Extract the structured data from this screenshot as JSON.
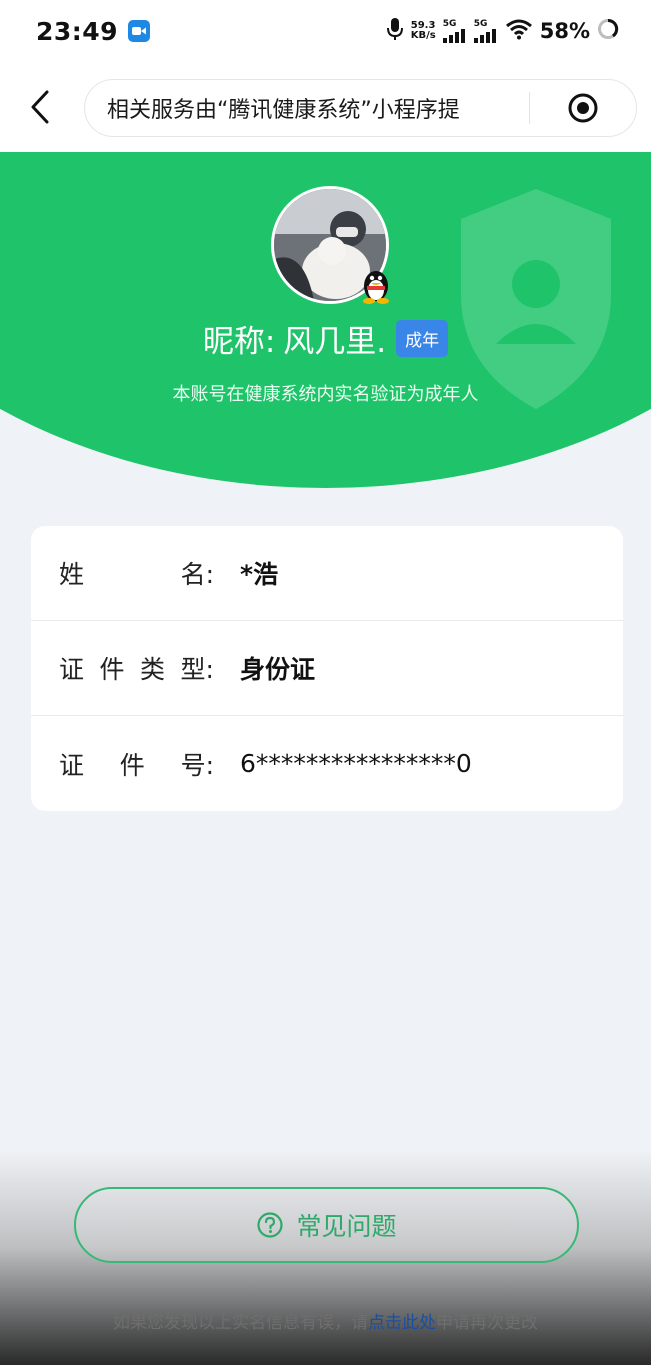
{
  "status_bar": {
    "time": "23:49",
    "net_speed_value": "59.3",
    "net_speed_unit": "KB/s",
    "sim1_label": "5G",
    "sim2_label": "5G",
    "battery": "58%",
    "icons": [
      "video-call-icon",
      "microphone-icon",
      "signal-icon",
      "wifi-icon",
      "battery-icon"
    ]
  },
  "nav": {
    "title": "相关服务由“腾讯健康系统”小程序提"
  },
  "profile": {
    "nickname_label": "昵称:",
    "nickname": "风几里.",
    "age_tag": "成年",
    "verify_text": "本账号在健康系统内实名验证为成年人"
  },
  "info": {
    "rows": [
      {
        "label_chars": [
          "姓",
          "名:"
        ],
        "value": "*浩"
      },
      {
        "label_chars": [
          "证",
          "件",
          "类",
          "型:"
        ],
        "value": "身份证"
      },
      {
        "label_chars": [
          "证",
          "件",
          "号:"
        ],
        "value": "6****************0"
      }
    ]
  },
  "faq": {
    "label": "常见问题"
  },
  "footer": {
    "prefix": "如果您发现以上实名信息有误，请",
    "link": "点击此处",
    "suffix": "申请再次更改"
  },
  "colors": {
    "brand_green": "#1fc46a",
    "faq_green": "#2ea96a",
    "tag_blue": "#3a86e8",
    "link_blue": "#1a4fa0"
  }
}
